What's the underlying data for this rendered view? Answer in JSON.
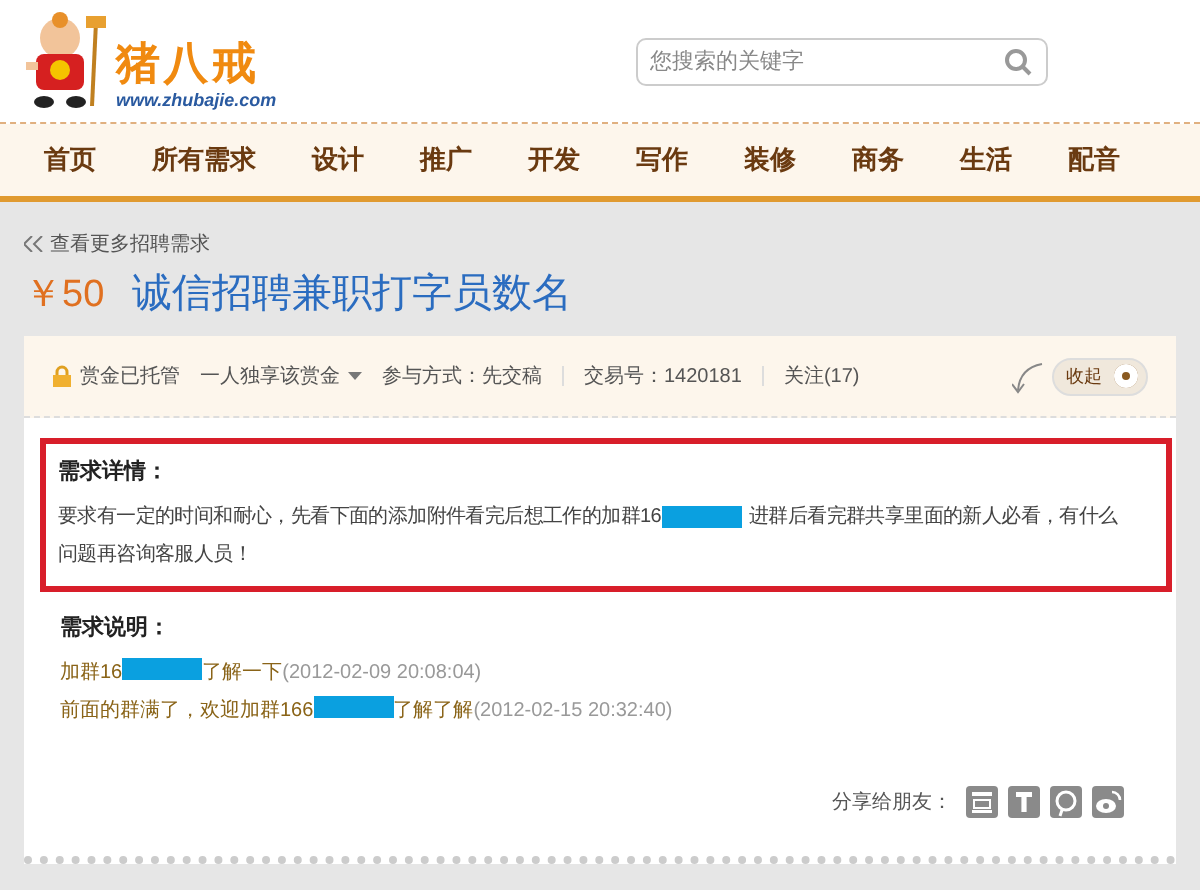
{
  "header": {
    "logo_text": "猪八戒",
    "logo_url": "www.zhubajie.com",
    "search": {
      "placeholder": "您搜索的关键字"
    }
  },
  "nav": [
    {
      "label": "首页"
    },
    {
      "label": "所有需求"
    },
    {
      "label": "设计"
    },
    {
      "label": "推广"
    },
    {
      "label": "开发"
    },
    {
      "label": "写作"
    },
    {
      "label": "装修"
    },
    {
      "label": "商务"
    },
    {
      "label": "生活"
    },
    {
      "label": "配音"
    }
  ],
  "back_link": "查看更多招聘需求",
  "task": {
    "price": "￥50",
    "title": "诚信招聘兼职打字员数名"
  },
  "info_bar": {
    "escrow": "赏金已托管",
    "mode": "一人独享该赏金",
    "participation": "参与方式：先交稿",
    "trade_no": "交易号：1420181",
    "follow": "关注(17)",
    "toggle": {
      "label": "收起",
      "on": true
    }
  },
  "detail": {
    "heading": "需求详情：",
    "highlighted": true,
    "lines": [
      [
        {
          "kind": "text",
          "text": "要求有一定的时间和耐心，先看下面的添加附件看完后想工作的加群16"
        },
        {
          "kind": "redacted"
        },
        {
          "kind": "text",
          "text": "进群后看完群共享里面的新人必看，有什么"
        }
      ],
      [
        {
          "kind": "text",
          "text": "问题再咨询客服人员！"
        }
      ]
    ]
  },
  "notes": {
    "heading": "需求说明：",
    "items": [
      {
        "parts": [
          {
            "kind": "text",
            "text": "加群16"
          },
          {
            "kind": "redacted"
          },
          {
            "kind": "text",
            "text": "了解一下"
          }
        ],
        "time": "(2012-02-09 20:08:04)"
      },
      {
        "parts": [
          {
            "kind": "text",
            "text": "前面的群满了，欢迎加群166"
          },
          {
            "kind": "redacted"
          },
          {
            "kind": "text",
            "text": "了解了解"
          }
        ],
        "time": "(2012-02-15 20:32:40)"
      }
    ]
  },
  "share": {
    "label": "分享给朋友："
  }
}
